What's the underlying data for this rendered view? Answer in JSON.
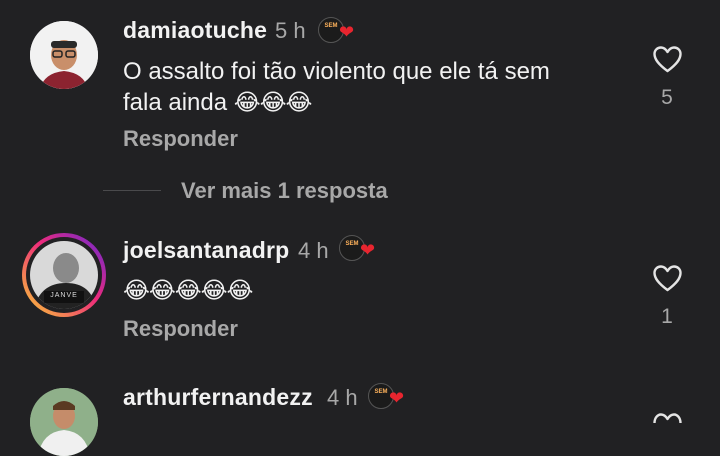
{
  "comments": [
    {
      "username": "damiaotuche",
      "time": "5 h",
      "badge_text": "SEM",
      "text_line1": "O assalto foi tão violento que ele tá sem",
      "text_line2": "fala ainda",
      "emojis": "😂😂😂",
      "reply_label": "Responder",
      "like_count": "5",
      "like_icon": "heart-outline-icon"
    },
    {
      "username": "joelsantanadrp",
      "time": "4 h",
      "badge_text": "SEM",
      "avatar_caption": "JANVE",
      "emojis": "😂😂😂😂😂",
      "reply_label": "Responder",
      "like_count": "1",
      "like_icon": "heart-outline-icon"
    },
    {
      "username": "arthurfernandezz",
      "time": "4 h",
      "badge_text": "SEM",
      "like_icon": "heart-outline-icon"
    }
  ],
  "view_more_replies": "Ver mais 1 resposta",
  "colors": {
    "background": "#212123",
    "secondary_text": "#a8a8a8",
    "heart_red": "#e8252f",
    "story_ring_start": "#f9ce34",
    "story_ring_mid": "#ee2a7b",
    "story_ring_end": "#6228d7"
  }
}
